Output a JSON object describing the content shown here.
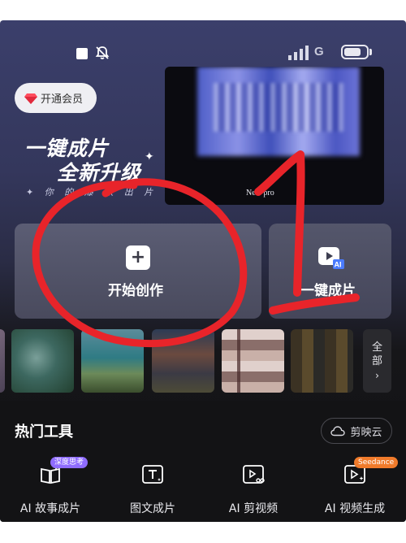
{
  "status_bar": {
    "network": "G",
    "icons": [
      "square-icon",
      "bell-mute-icon",
      "signal-icon",
      "battery-icon"
    ]
  },
  "vip": {
    "label": "开通会员",
    "icon": "gem-icon"
  },
  "promo": {
    "line1": "一键成片",
    "line2": "全新升级",
    "subtitle": "✦ 你 的 爆 款 出 片 神 器 ✦",
    "preview_caption": "New pro"
  },
  "actions": {
    "start": {
      "label": "开始创作",
      "icon": "plus-icon"
    },
    "ai_film": {
      "label": "一键成片",
      "icon": "ai-video-icon"
    }
  },
  "thumbnails": {
    "more_label": "全部",
    "more_icon": "chevron-right-icon"
  },
  "hot_tools": {
    "title": "热门工具",
    "cloud_button": "剪映云",
    "items": [
      {
        "label": "AI 故事成片",
        "icon": "book-sparkle-icon",
        "badge": "深度思考"
      },
      {
        "label": "图文成片",
        "icon": "text-frame-icon",
        "badge": ""
      },
      {
        "label": "AI 剪视频",
        "icon": "video-scissors-icon",
        "badge": ""
      },
      {
        "label": "AI 视频生成",
        "icon": "video-sparkle-icon",
        "badge": "Seedance"
      }
    ]
  },
  "colors": {
    "accent_badge": "#8f6cff",
    "seedance_badge": "#f07b2b",
    "annotation_red": "#e8242a"
  },
  "annotations": {
    "number_mark": "1"
  }
}
